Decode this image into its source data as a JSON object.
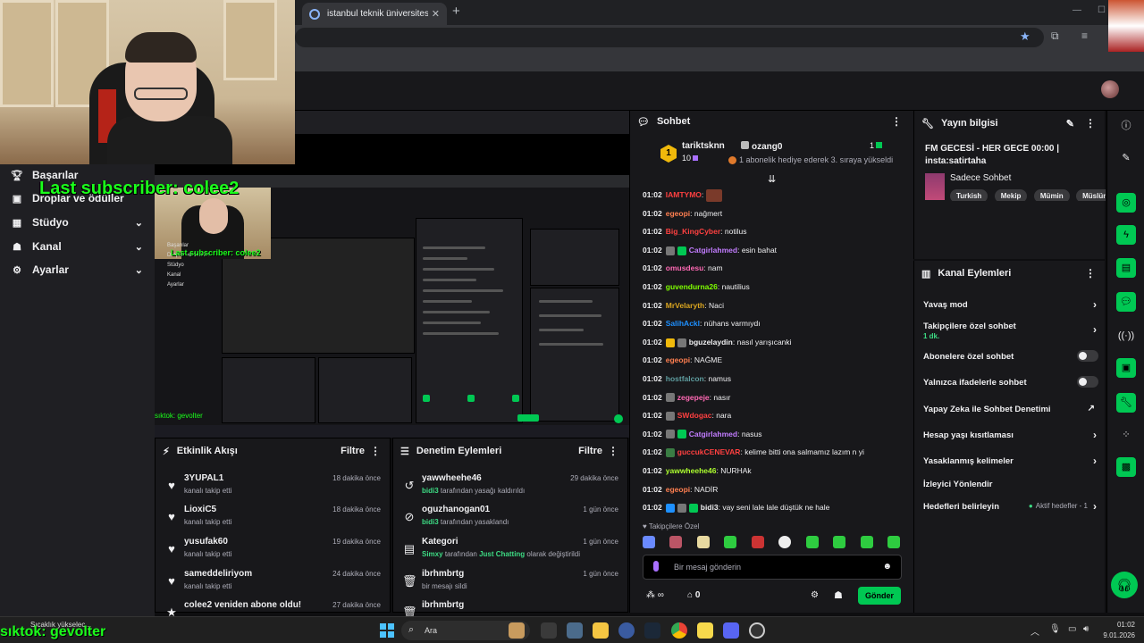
{
  "browser": {
    "tab_title": "istanbul teknik üniversitesi deka",
    "tab_close": "✕",
    "new_tab": "+"
  },
  "overlay": {
    "last_subscriber": "Last subscriber: colee2",
    "mini_last_subscriber": "Last subscriber: colee2",
    "bottom_tiktok": "sıktok: gevolter",
    "mini_tiktok": "sıktok: gevolter"
  },
  "leftnav": {
    "items": [
      {
        "label": "Başarılar",
        "icon": "trophy-icon"
      },
      {
        "label": "Droplar ve ödüller",
        "icon": "gift-icon"
      },
      {
        "label": "Stüdyo",
        "icon": "grid-icon",
        "expandable": true
      },
      {
        "label": "Kanal",
        "icon": "people-icon",
        "expandable": true
      },
      {
        "label": "Ayarlar",
        "icon": "gear-icon",
        "expandable": true
      }
    ]
  },
  "mini_nav": [
    "Başarılar",
    "Droplar ve ödüller",
    "Stüdyo",
    "Kanal",
    "Ayarlar"
  ],
  "activity": {
    "title": "Etkinlik Akışı",
    "filter": "Filtre",
    "items": [
      {
        "name": "3YUPAL1",
        "desc": "kanalı takip etti",
        "time": "18 dakika önce"
      },
      {
        "name": "LioxiC5",
        "desc": "kanalı takip etti",
        "time": "18 dakika önce"
      },
      {
        "name": "yusufak60",
        "desc": "kanalı takip etti",
        "time": "19 dakika önce"
      },
      {
        "name": "sameddeliriyom",
        "desc": "kanalı takip etti",
        "time": "24 dakika önce"
      },
      {
        "name": "colee2 veniden abone oldu!",
        "desc": "",
        "time": "27 dakika önce"
      }
    ]
  },
  "moderation": {
    "title": "Denetim Eylemleri",
    "filter": "Filtre",
    "items": [
      {
        "name": "yawwheehe46",
        "actor": "bidi3",
        "desc": "tarafından yasağı kaldırıldı",
        "time": "29 dakika önce",
        "icon": "unban-icon"
      },
      {
        "name": "oguzhanogan01",
        "actor": "bidi3",
        "desc": "tarafından yasaklandı",
        "time": "1 gün önce",
        "icon": "ban-icon"
      },
      {
        "name": "Kategori",
        "actor": "Simxy",
        "desc": "tarafından",
        "extra": "Just Chatting",
        "extra2": "olarak değiştirildi",
        "time": "1 gün önce",
        "icon": "category-icon"
      },
      {
        "name": "ibrhmbrtg",
        "actor": "",
        "desc": "bir mesajı sildi",
        "time": "1 gün önce",
        "icon": "trash-icon"
      },
      {
        "name": "ibrhmbrtg",
        "actor": "",
        "desc": "",
        "time": "",
        "icon": "trash-icon"
      }
    ]
  },
  "chat": {
    "title": "Sohbet",
    "hype": {
      "rank": "1",
      "user": "tariktsknn",
      "count": "10"
    },
    "gift": {
      "user": "ozang0",
      "num": "1",
      "desc": "1 abonelik hediye ederek 3. sıraya yükseldi"
    },
    "messages": [
      {
        "ts": "01:02",
        "user": "IAMTYMO",
        "color": "#ff4040",
        "msg": "",
        "emote": true
      },
      {
        "ts": "01:02",
        "user": "egeopi",
        "color": "#ff7f50",
        "msg": "nağmert"
      },
      {
        "ts": "01:02",
        "user": "Big_KingCyber",
        "color": "#ff4040",
        "msg": "notilus"
      },
      {
        "ts": "01:02",
        "user": "Catgirlahmed",
        "color": "#c27cff",
        "msg": "esin bahat",
        "badges": [
          "#777",
          "#00c853"
        ]
      },
      {
        "ts": "01:02",
        "user": "omusdesu",
        "color": "#ff69b4",
        "msg": "nam"
      },
      {
        "ts": "01:02",
        "user": "guvendurna26",
        "color": "#7fff00",
        "msg": "nautilius"
      },
      {
        "ts": "01:02",
        "user": "MrVelaryth",
        "color": "#daa520",
        "msg": "Naci"
      },
      {
        "ts": "01:02",
        "user": "SalihAckl",
        "color": "#1e90ff",
        "msg": "nühans varmıydı"
      },
      {
        "ts": "01:02",
        "user": "bguzelaydin",
        "color": "#efeff1",
        "msg": "nasıl yarışıcanki",
        "badges": [
          "#f0b90b",
          "#777"
        ]
      },
      {
        "ts": "01:02",
        "user": "egeopi",
        "color": "#ff7f50",
        "msg": "NAĞME"
      },
      {
        "ts": "01:02",
        "user": "hostfalcon",
        "color": "#5f9ea0",
        "msg": "namus"
      },
      {
        "ts": "01:02",
        "user": "zegepeje",
        "color": "#ff69b4",
        "msg": "nasır",
        "badges": [
          "#777"
        ]
      },
      {
        "ts": "01:02",
        "user": "SWdogac",
        "color": "#ff4040",
        "msg": "nara",
        "badges": [
          "#777"
        ]
      },
      {
        "ts": "01:02",
        "user": "Catgirlahmed",
        "color": "#c27cff",
        "msg": "nasus",
        "badges": [
          "#777",
          "#00c853"
        ]
      },
      {
        "ts": "01:02",
        "user": "guccukCENEVAR",
        "color": "#ff4040",
        "msg": "kelime bitti ona salmamız lazım n yi",
        "badges": [
          "#3a7d44"
        ]
      },
      {
        "ts": "01:02",
        "user": "yawwheehe46",
        "color": "#adff2f",
        "msg": "NURHAk"
      },
      {
        "ts": "01:02",
        "user": "egeopi",
        "color": "#ff7f50",
        "msg": "NADİR"
      },
      {
        "ts": "01:02",
        "user": "bidi3",
        "color": "#efeff1",
        "msg": "vay seni lale lale düştük ne hale",
        "badges": [
          "#1e90ff",
          "#777",
          "#00c853"
        ]
      }
    ],
    "emote_label": "♥ Takipçilere Özel",
    "input_placeholder": "Bir mesaj gönderin",
    "points": "∞",
    "gifts": "0",
    "send": "Gönder"
  },
  "stream_info": {
    "title": "Yayın bilgisi",
    "stream_title": "FM GECESİ - HER GECE 00:00 | insta:satirtaha",
    "category": "Sadece Sohbet",
    "tags": [
      "Turkish",
      "Mekip",
      "Mümin",
      "Müslüm"
    ]
  },
  "channel_actions": {
    "title": "Kanal Eylemleri",
    "items": [
      {
        "label": "Yavaş mod",
        "type": "chevron"
      },
      {
        "label": "Takipçilere özel sohbet",
        "sub": "1 dk.",
        "type": "chevron"
      },
      {
        "label": "Abonelere özel sohbet",
        "type": "toggle"
      },
      {
        "label": "Yalnızca ifadelerle sohbet",
        "type": "toggle"
      },
      {
        "label": "Yapay Zeka ile Sohbet Denetimi",
        "type": "external"
      },
      {
        "label": "Hesap yaşı kısıtlaması",
        "type": "chevron"
      },
      {
        "label": "Yasaklanmış kelimeler",
        "type": "chevron"
      },
      {
        "label": "İzleyici Yönlendir",
        "type": "none"
      },
      {
        "label": "Hedefleri belirleyin",
        "goal": "Aktif hedefler - 1",
        "type": "chevron"
      }
    ]
  },
  "taskbar": {
    "weather": "Sıcaklık yükselec...",
    "search": "Ara",
    "time": "01:02",
    "date": "9.01.2026"
  }
}
